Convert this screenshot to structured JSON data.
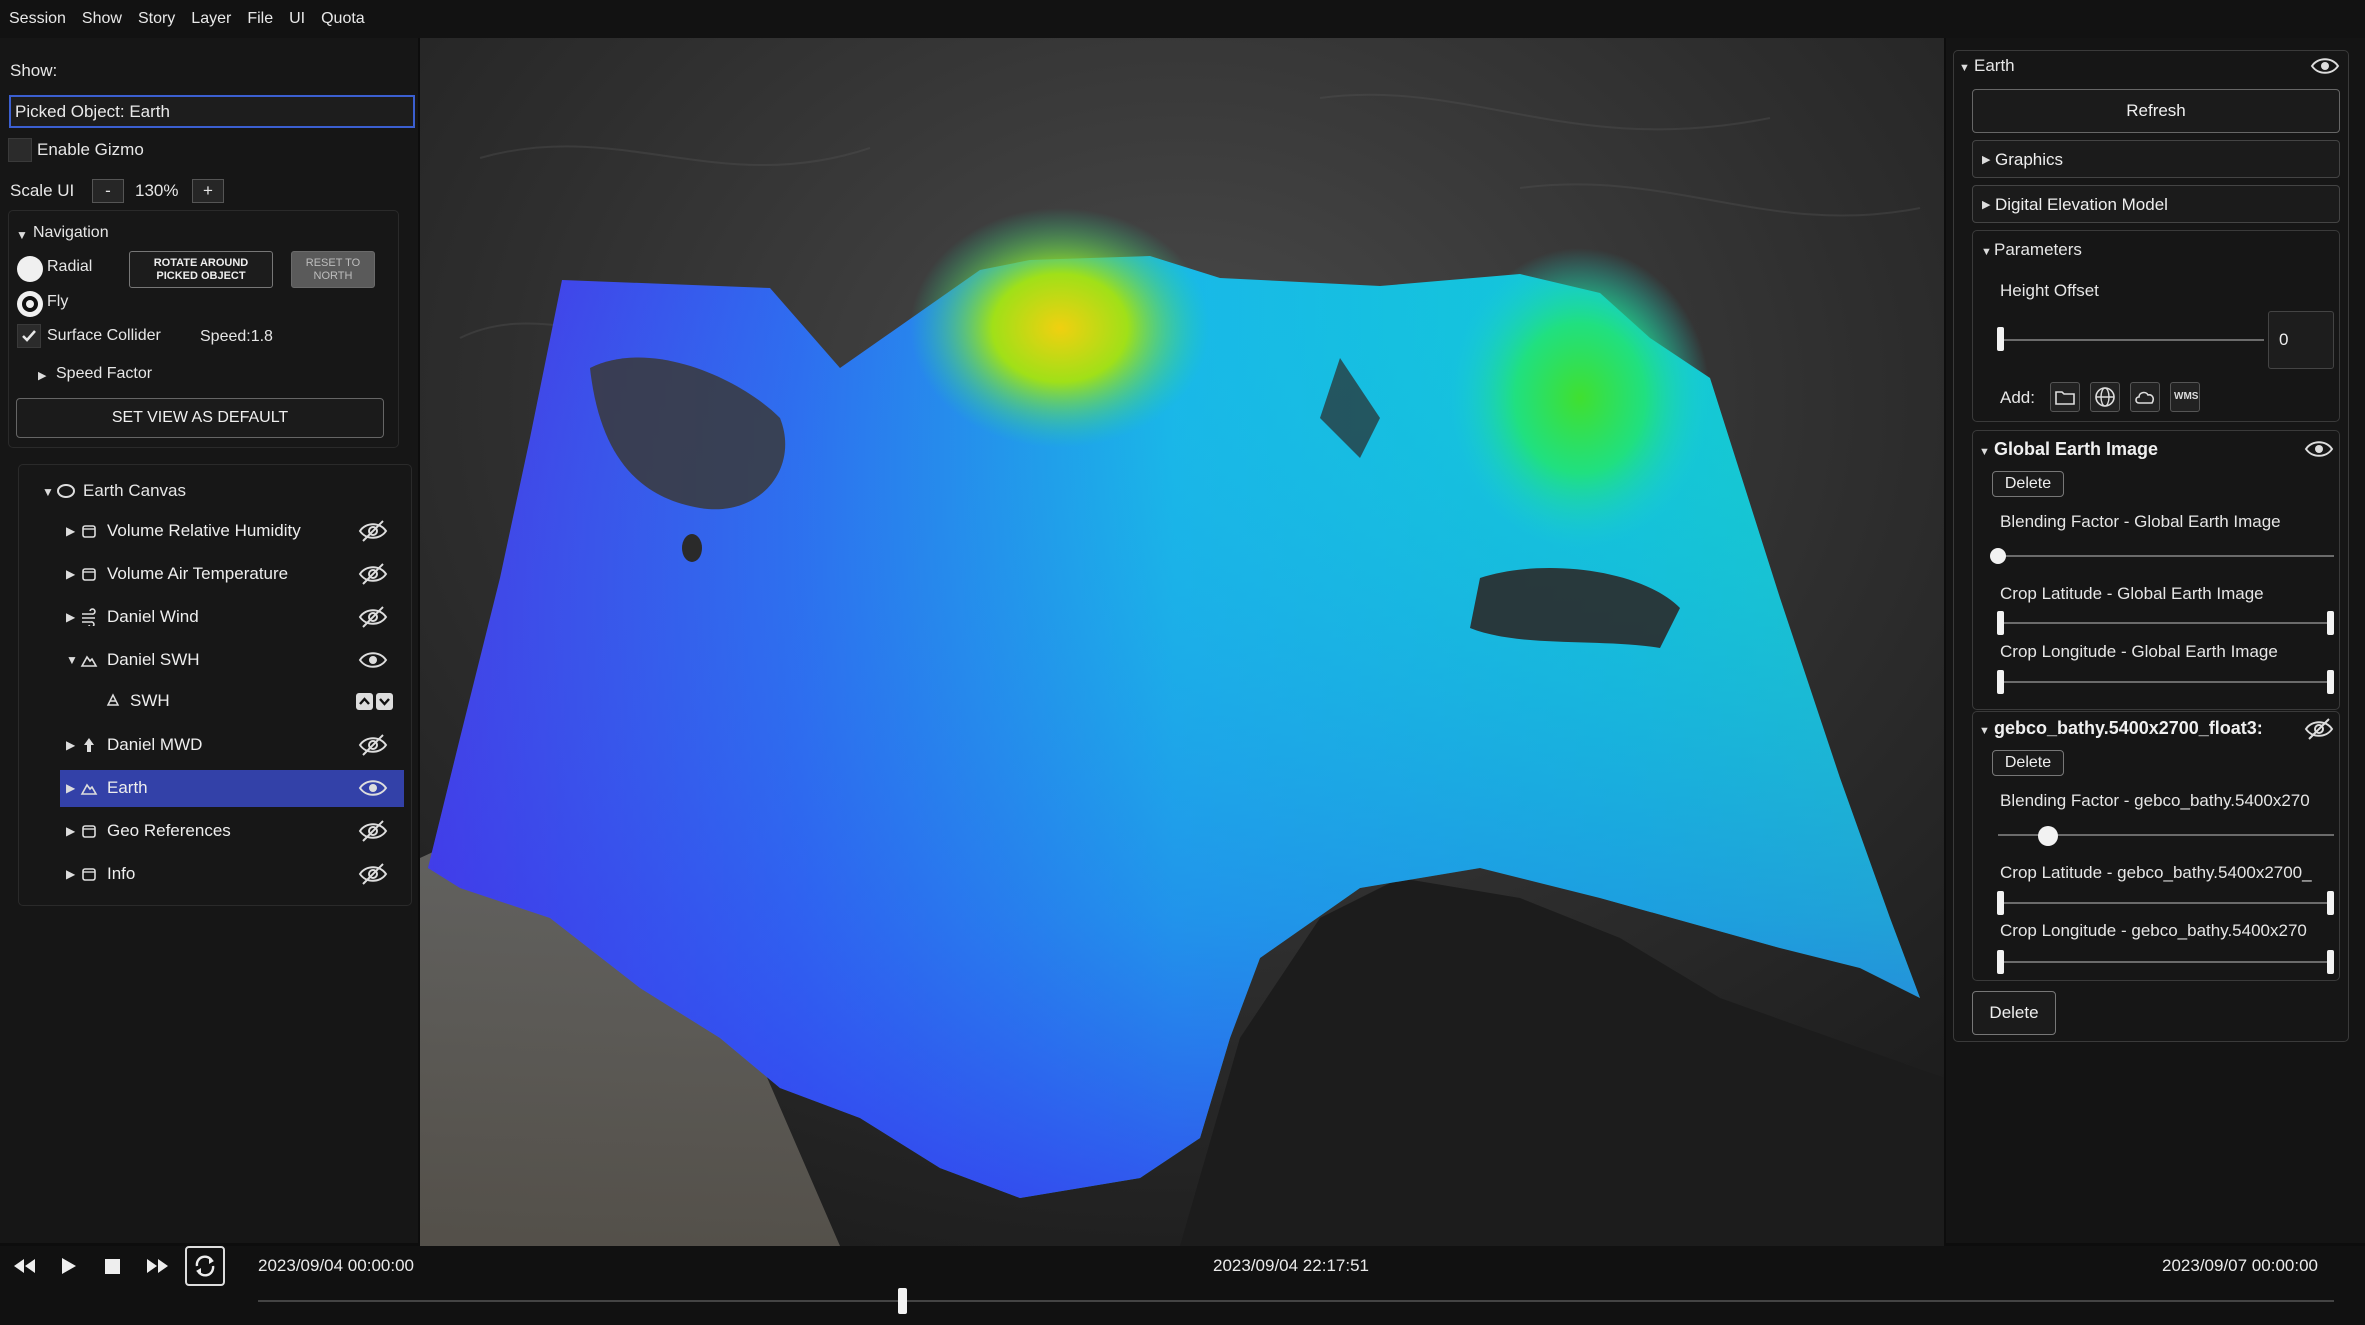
{
  "menu": [
    "Session",
    "Show",
    "Story",
    "Layer",
    "File",
    "UI",
    "Quota"
  ],
  "left": {
    "show_label": "Show:",
    "picked_object": "Picked Object: Earth",
    "enable_gizmo": "Enable Gizmo",
    "scale_ui_label": "Scale UI",
    "scale_minus": "-",
    "scale_value": "130%",
    "scale_plus": "+",
    "navigation": {
      "title": "Navigation",
      "radial": "Radial",
      "fly": "Fly",
      "rotate_btn_line1": "ROTATE AROUND",
      "rotate_btn_line2": "PICKED OBJECT",
      "reset_btn_line1": "RESET TO",
      "reset_btn_line2": "NORTH",
      "surface_collider": "Surface Collider",
      "speed": "Speed:1.8",
      "speed_factor": "Speed Factor",
      "set_view_default": "SET VIEW AS DEFAULT"
    },
    "tree": {
      "root": "Earth Canvas",
      "items": [
        {
          "label": "Volume Relative Humidity",
          "visible": false
        },
        {
          "label": "Volume Air Temperature",
          "visible": false
        },
        {
          "label": "Daniel Wind",
          "visible": false
        },
        {
          "label": "Daniel SWH",
          "visible": true
        },
        {
          "label": "SWH"
        },
        {
          "label": "Daniel MWD",
          "visible": false
        },
        {
          "label": "Earth",
          "visible": true,
          "selected": true
        },
        {
          "label": "Geo References",
          "visible": false
        },
        {
          "label": "Info",
          "visible": false
        }
      ]
    }
  },
  "right": {
    "title": "Earth",
    "refresh": "Refresh",
    "graphics": "Graphics",
    "dem": "Digital Elevation Model",
    "parameters": "Parameters",
    "height_offset_label": "Height Offset",
    "height_offset_value": "0",
    "add_label": "Add:",
    "add_icons": [
      "folder-icon",
      "globe-icon",
      "cloud-icon",
      "wms-icon"
    ],
    "wms_text": "WMS",
    "layer1": {
      "title": "Global Earth Image",
      "delete": "Delete",
      "blend_label": "Blending Factor - Global Earth Image",
      "blend_value": 0.0,
      "crop_lat_label": "Crop Latitude - Global Earth Image",
      "crop_lon_label": "Crop Longitude - Global Earth Image"
    },
    "layer2": {
      "title": "gebco_bathy.5400x2700_float3:",
      "delete": "Delete",
      "blend_label": "Blending Factor - gebco_bathy.5400x270",
      "blend_value": 0.15,
      "crop_lat_label": "Crop Latitude - gebco_bathy.5400x2700_",
      "crop_lon_label": "Crop Longitude - gebco_bathy.5400x270"
    },
    "delete_bottom": "Delete"
  },
  "timeline": {
    "start": "2023/09/04 00:00:00",
    "current": "2023/09/04 22:17:51",
    "end": "2023/09/07 00:00:00",
    "position": 0.31
  }
}
